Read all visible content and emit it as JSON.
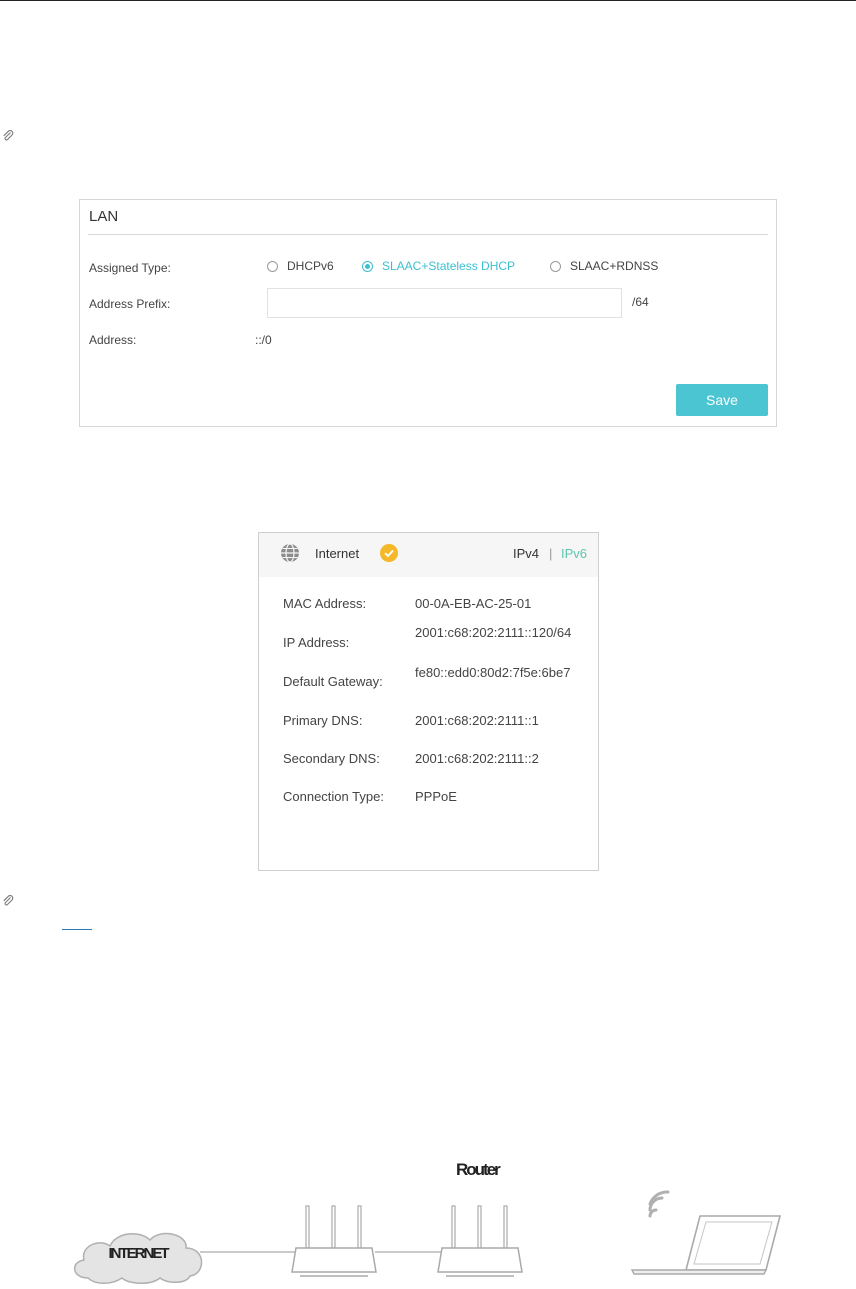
{
  "lan": {
    "title": "LAN",
    "assigned_type_label": "Assigned Type:",
    "options": [
      "DHCPv6",
      "SLAAC+Stateless DHCP",
      "SLAAC+RDNSS"
    ],
    "selected_option": "SLAAC+Stateless DHCP",
    "address_prefix_label": "Address Prefix:",
    "address_prefix_value": "",
    "address_prefix_suffix": "/64",
    "address_label": "Address:",
    "address_value": "::/0",
    "save_label": "Save"
  },
  "internet": {
    "title": "Internet",
    "tab_ipv4": "IPv4",
    "tab_separator": "|",
    "tab_ipv6": "IPv6",
    "active_tab": "IPv6",
    "rows": [
      {
        "label": "MAC Address:",
        "value": "00-0A-EB-AC-25-01"
      },
      {
        "label": "IP Address:",
        "value": "2001:c68:202:2111::120/64"
      },
      {
        "label": "Default Gateway:",
        "value": "fe80::edd0:80d2:7f5e:6be7"
      },
      {
        "label": "Primary DNS:",
        "value": "2001:c68:202:2111::1"
      },
      {
        "label": "Secondary DNS:",
        "value": "2001:c68:202:2111::2"
      },
      {
        "label": "Connection Type:",
        "value": "PPPoE"
      }
    ]
  },
  "diagram": {
    "internet_label": "INTERNET",
    "router_label": "Router"
  },
  "colors": {
    "accent": "#3bbfcf",
    "save_button": "#4cc5d3",
    "ipv6_tab": "#5cc6b0",
    "status": "#f4b829"
  },
  "icons": [
    "note-clip-icon",
    "globe-icon",
    "status-check-icon",
    "cloud-icon",
    "router-icon",
    "wifi-icon",
    "laptop-icon"
  ]
}
